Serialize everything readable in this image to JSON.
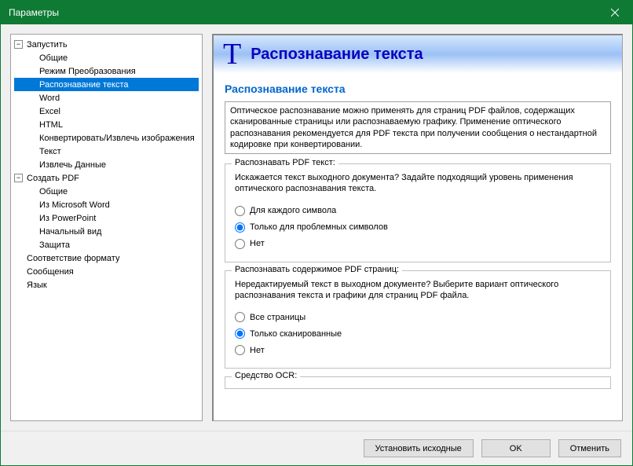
{
  "window": {
    "title": "Параметры"
  },
  "tree": {
    "launch": {
      "label": "Запустить"
    },
    "launch_children": {
      "general": "Общие",
      "conversion_mode": "Режим Преобразования",
      "text_recognition": "Распознавание текста",
      "word": "Word",
      "excel": "Excel",
      "html": "HTML",
      "convert_extract": "Конвертировать/Извлечь изображения",
      "text": "Текст",
      "extract_data": "Извлечь Данные"
    },
    "create_pdf": {
      "label": "Создать PDF"
    },
    "create_pdf_children": {
      "general": "Общие",
      "from_word": "Из Microsoft Word",
      "from_ppt": "Из PowerPoint",
      "initial_view": "Начальный вид",
      "security": "Защита"
    },
    "format_compliance": "Соответствие формату",
    "messages": "Сообщения",
    "language": "Язык"
  },
  "header": {
    "title": "Распознавание текста"
  },
  "section": {
    "title": "Распознавание текста",
    "info": "Оптическое распознавание можно применять для страниц PDF файлов, содержащих сканированные страницы или распознаваемую графику. Применение оптического распознавания рекомендуется для PDF текста при получении сообщения о нестандартной кодировке при конвертировании."
  },
  "group1": {
    "title": "Распознавать PDF текст:",
    "desc": "Искажается текст выходного документа? Задайте подходящий уровень применения оптического распознавания текста.",
    "opt1": "Для каждого символа",
    "opt2": "Только для проблемных символов",
    "opt3": "Нет"
  },
  "group2": {
    "title": "Распознавать содержимое PDF страниц:",
    "desc": "Нередактируемый текст в выходном документе? Выберите вариант оптического распознавания текста и графики для страниц PDF файла.",
    "opt1": "Все страницы",
    "opt2": "Только сканированные",
    "opt3": "Нет"
  },
  "group3": {
    "title": "Средство OCR:"
  },
  "footer": {
    "reset": "Установить исходные",
    "ok": "OK",
    "cancel": "Отменить"
  }
}
